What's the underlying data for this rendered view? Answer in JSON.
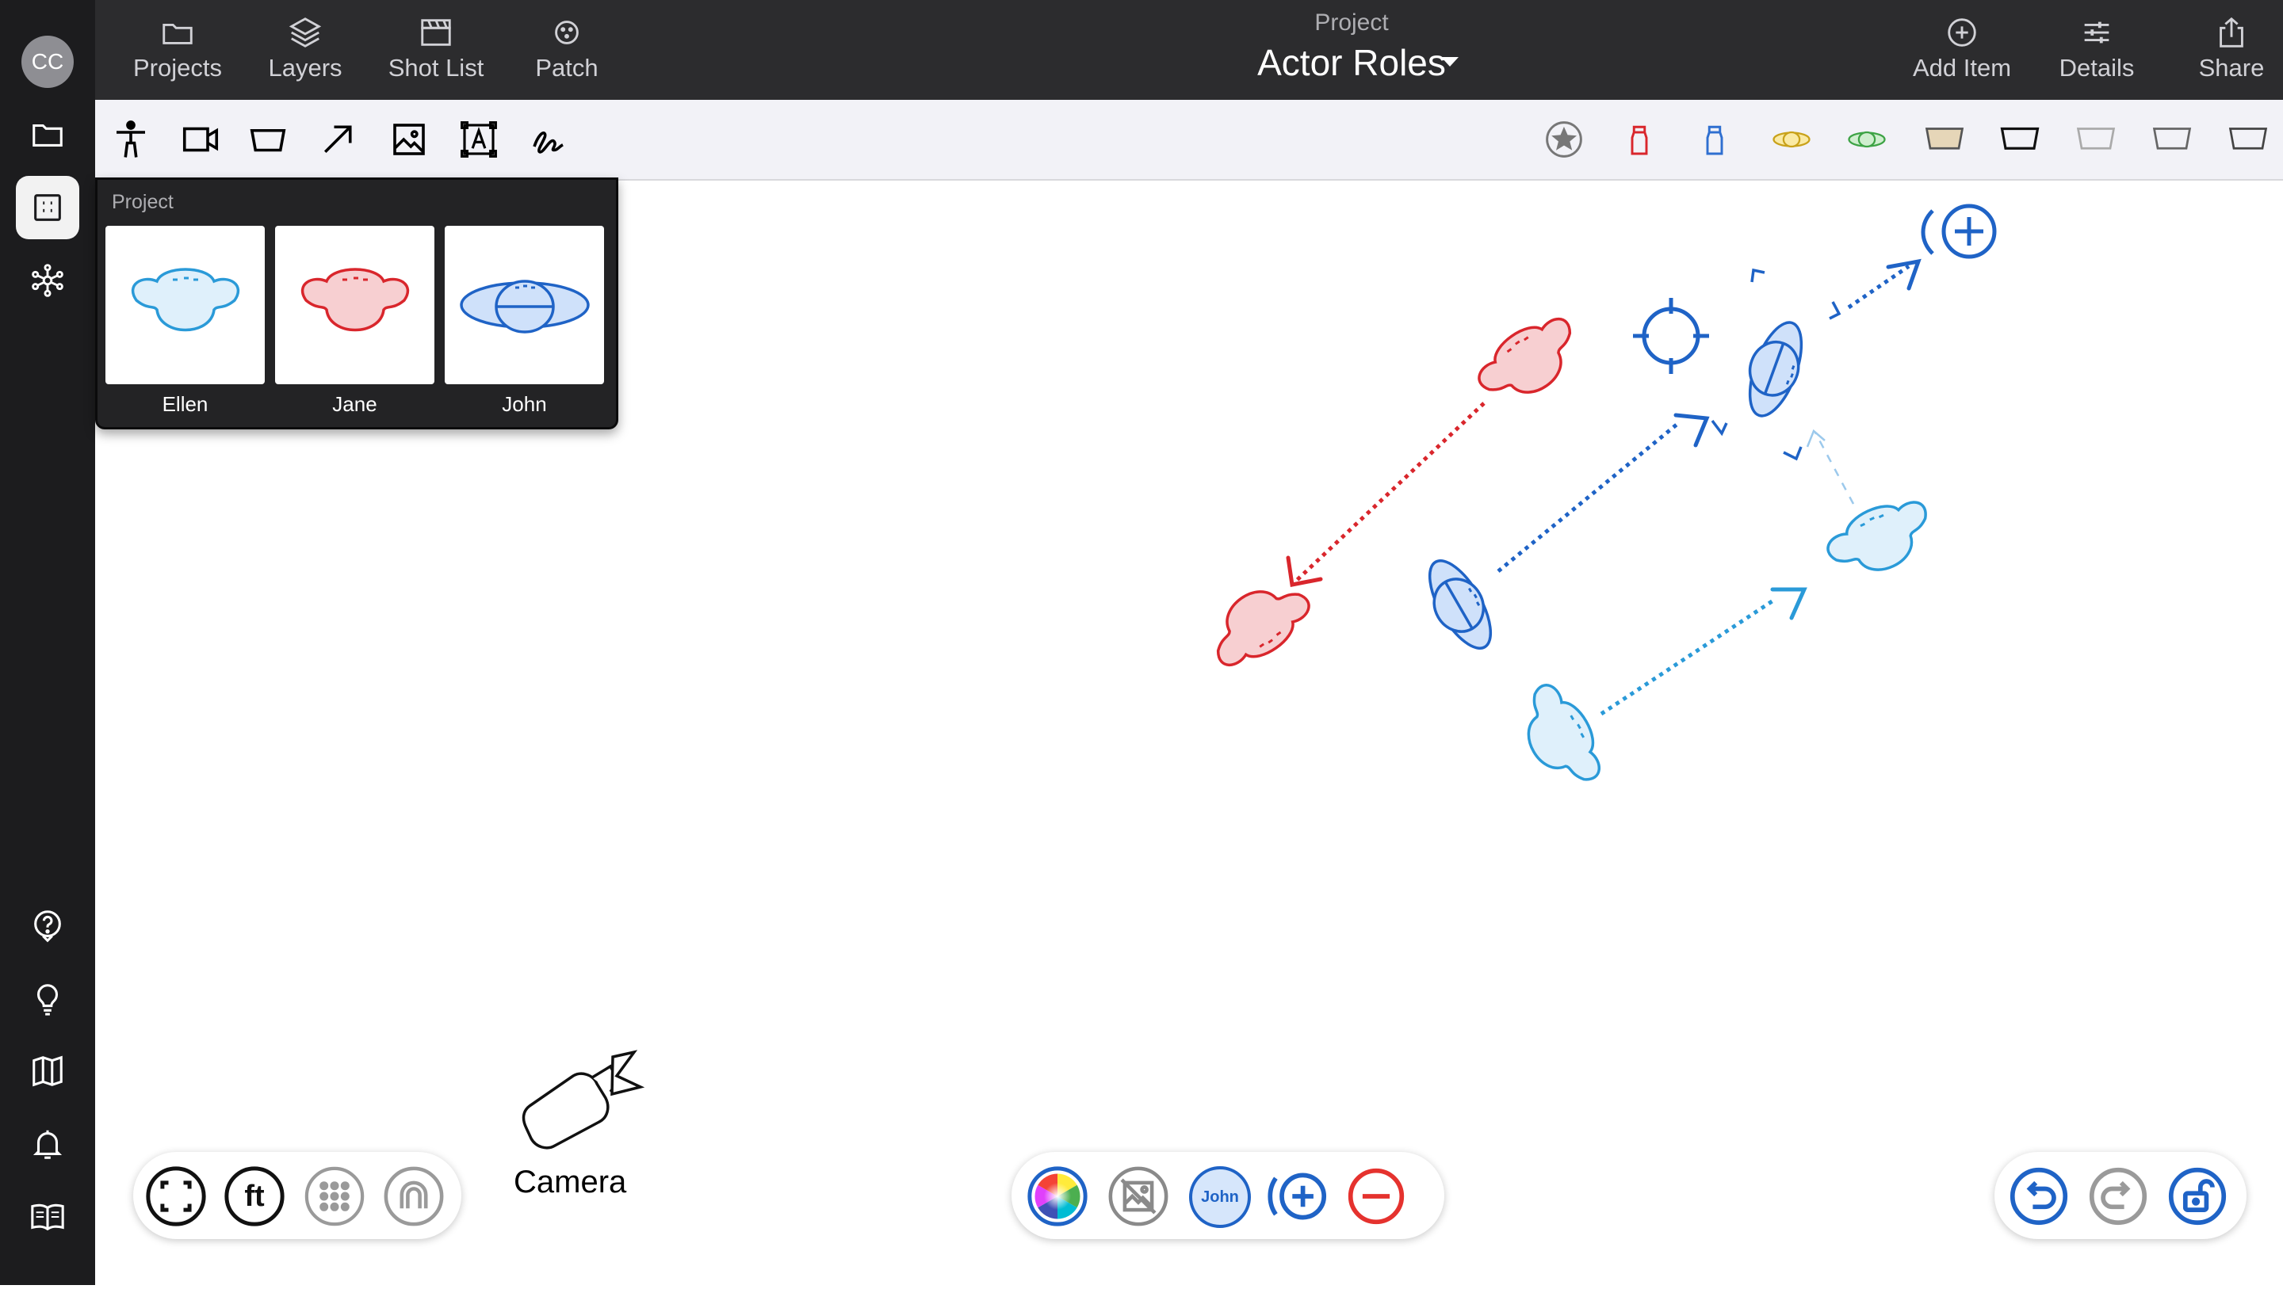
{
  "app": {
    "user_initials": "CC"
  },
  "header": {
    "subtitle": "Project",
    "title": "Actor Roles",
    "nav": {
      "projects": "Projects",
      "layers": "Layers",
      "shot_list": "Shot List",
      "patch": "Patch"
    },
    "actions": {
      "add_item": "Add Item",
      "details": "Details",
      "share": "Share"
    }
  },
  "popup": {
    "title": "Project",
    "actors": [
      {
        "name": "Ellen",
        "color": "#2a9ad8"
      },
      {
        "name": "Jane",
        "color": "#d9262c"
      },
      {
        "name": "John",
        "color": "#1f63c6"
      }
    ]
  },
  "palette_colors": {
    "red": "#d9262c",
    "blue": "#2f6fd0",
    "yellow": "#f0c63d",
    "green": "#43b34a",
    "tan": "#e6d6b8"
  },
  "canvas": {
    "camera_label": "Camera"
  },
  "bottom": {
    "unit_label": "ft",
    "selected_actor": "John"
  }
}
